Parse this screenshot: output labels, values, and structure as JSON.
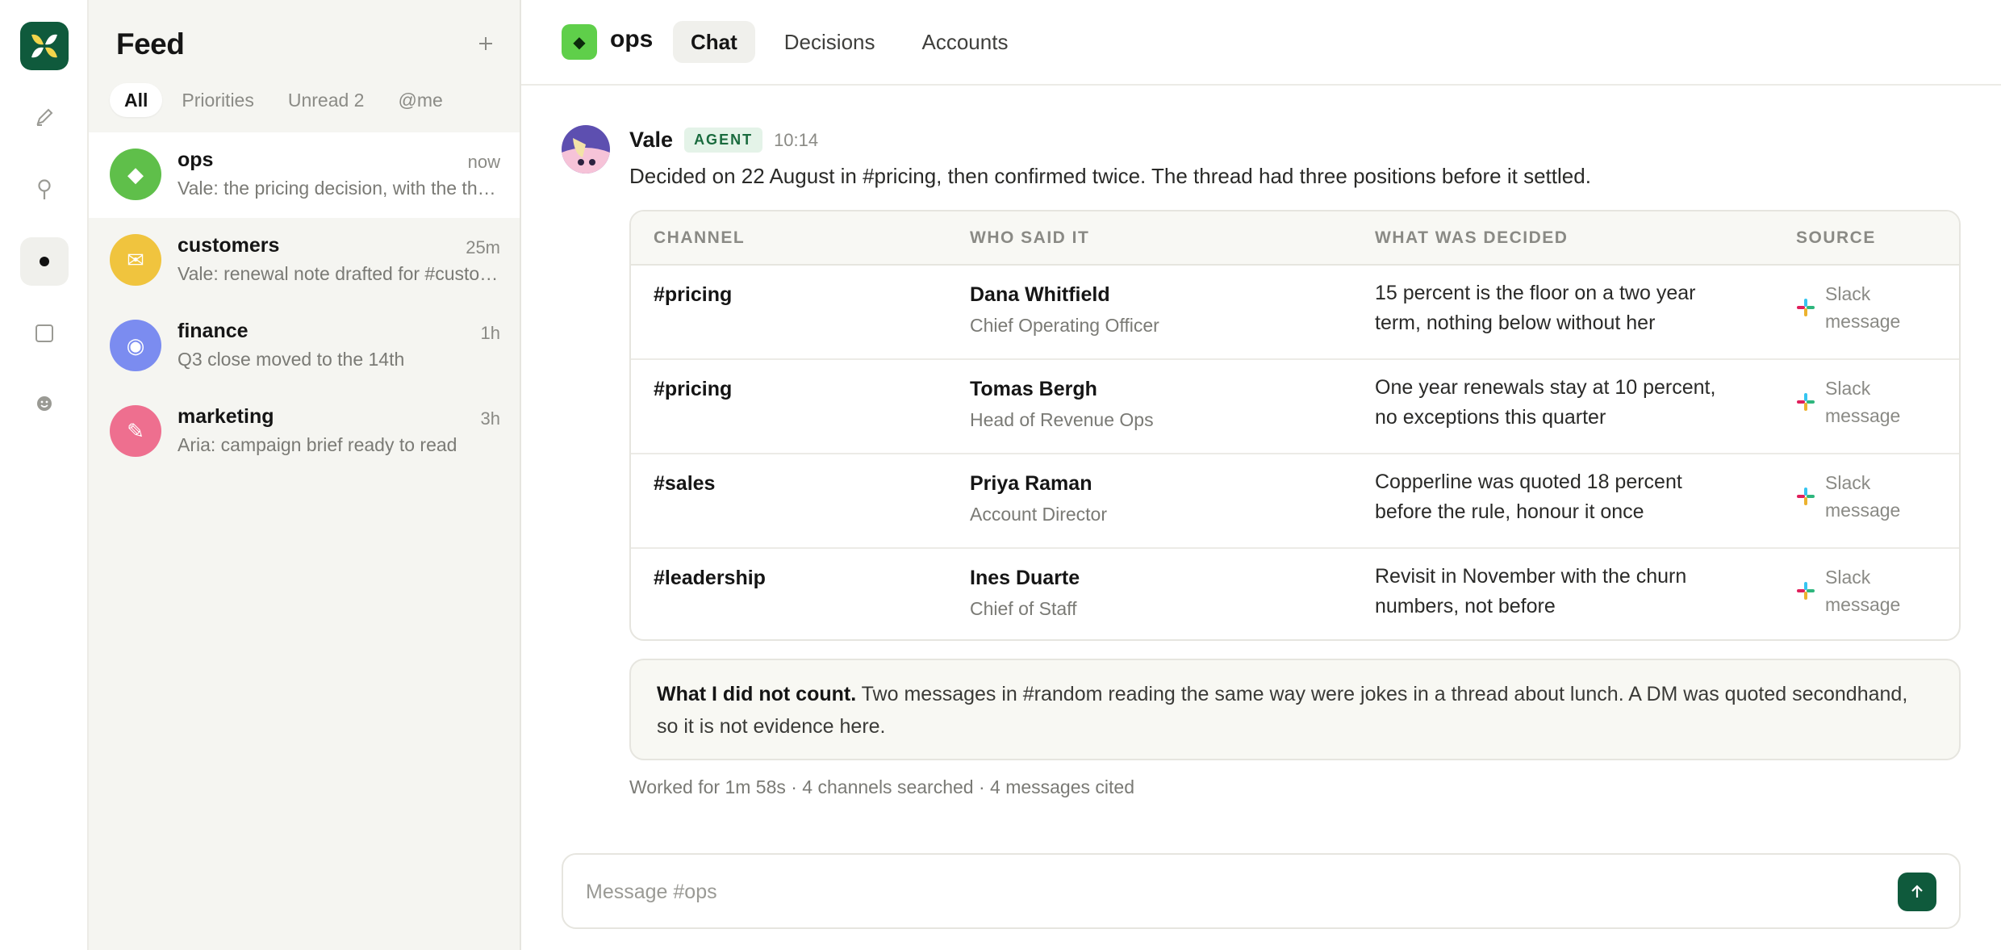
{
  "rail": {
    "items": [
      {
        "name": "compose",
        "icon": "pencil-icon"
      },
      {
        "name": "search",
        "icon": "search-icon"
      },
      {
        "name": "feed",
        "icon": "dot-icon",
        "active": true
      },
      {
        "name": "tasks",
        "icon": "square-icon"
      },
      {
        "name": "people",
        "icon": "smiley-icon"
      }
    ]
  },
  "feed": {
    "title": "Feed",
    "add_icon": "plus-icon",
    "filters": [
      "All",
      "Priorities",
      "Unread 2",
      "@me"
    ],
    "active_filter": "All",
    "items": [
      {
        "name": "ops",
        "time": "now",
        "preview": "Vale: the pricing decision, with the thread that settled it",
        "color": "#5fbf4a",
        "icon": "diamond-icon",
        "glyph": "◆"
      },
      {
        "name": "customers",
        "time": "25m",
        "preview": "Vale: renewal note drafted for #customers review",
        "color": "#f0c43e",
        "icon": "mail-icon",
        "glyph": "✉"
      },
      {
        "name": "finance",
        "time": "1h",
        "preview": "Q3 close moved to the 14th",
        "color": "#7b8cf0",
        "icon": "target-icon",
        "glyph": "◉"
      },
      {
        "name": "marketing",
        "time": "3h",
        "preview": "Aria: campaign brief ready to read",
        "color": "#ee6f8f",
        "icon": "pencil-icon",
        "glyph": "✎"
      }
    ]
  },
  "header": {
    "channel": "ops",
    "tabs": [
      "Chat",
      "Decisions",
      "Accounts"
    ],
    "active_tab": "Chat"
  },
  "message": {
    "author": "Vale",
    "badge": "AGENT",
    "time": "10:14",
    "text": "Decided on 22 August in #pricing, then confirmed twice. The thread had three positions before it settled.",
    "table": {
      "headers": [
        "CHANNEL",
        "WHO SAID IT",
        "WHAT WAS DECIDED",
        "SOURCE"
      ],
      "rows": [
        {
          "channel": "#pricing",
          "name": "Dana Whitfield",
          "role": "Chief Operating Officer",
          "decided": "15 percent is the floor on a two year term, nothing below without her",
          "source": "Slack message"
        },
        {
          "channel": "#pricing",
          "name": "Tomas Bergh",
          "role": "Head of Revenue Ops",
          "decided": "One year renewals stay at 10 percent, no exceptions this quarter",
          "source": "Slack message"
        },
        {
          "channel": "#sales",
          "name": "Priya Raman",
          "role": "Account Director",
          "decided": "Copperline was quoted 18 percent before the rule, honour it once",
          "source": "Slack message"
        },
        {
          "channel": "#leadership",
          "name": "Ines Duarte",
          "role": "Chief of Staff",
          "decided": "Revisit in November with the churn numbers, not before",
          "source": "Slack message"
        }
      ]
    },
    "note_title": "What I did not count.",
    "note_body": " Two messages in #random reading the same way were jokes in a thread about lunch. A DM was quoted secondhand, so it is not evidence here.",
    "meta": "Worked for 1m 58s · 4 channels searched · 4 messages cited"
  },
  "composer": {
    "placeholder": "Message #ops",
    "value": "",
    "send_icon": "arrow-up-icon"
  },
  "colors": {
    "brand": "#0f5a3c",
    "channel_icon": "#5fcf4a",
    "agent_badge_bg": "#e4f3e8",
    "agent_badge_text": "#1a6b3e"
  }
}
